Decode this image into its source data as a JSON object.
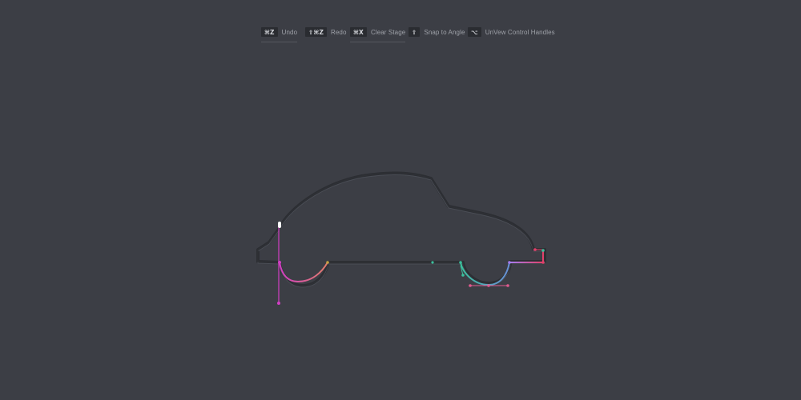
{
  "toolbar": {
    "undo": {
      "key": "⌘Z",
      "label": "Undo"
    },
    "redo": {
      "key": "⇧⌘Z",
      "label": "Redo"
    },
    "clear": {
      "key": "⌘X",
      "label": "Clear Stage"
    },
    "snap": {
      "key": "⇧",
      "label": "Snap to Angle"
    },
    "unview": {
      "key": "⌥",
      "label": "UnVew Control Handles"
    }
  },
  "colors": {
    "background": "#3c3e45",
    "guide_outline": "#2d2f34",
    "handle_magenta": "#d23fc4",
    "segment_pink": "#e05a8f",
    "segment_gold": "#c6a343",
    "segment_teal": "#3bbf9c",
    "segment_violet": "#a57cf2",
    "segment_red": "#e2406a"
  },
  "icons": {
    "selected_anchor": "anchor-handle-icon"
  }
}
